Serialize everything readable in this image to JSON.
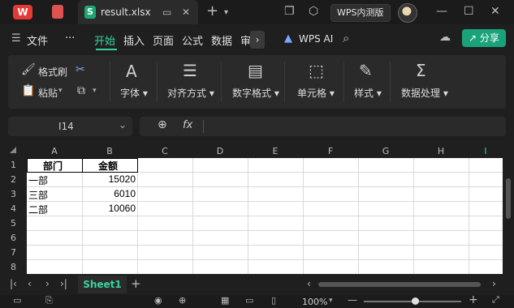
{
  "titlebar": {
    "app_logo": "W",
    "file_tab": "result.xlsx",
    "new_tab": "+",
    "badge": "WPS内测版"
  },
  "menubar": {
    "file": "文件",
    "more": "···",
    "items": [
      "开始",
      "插入",
      "页面",
      "公式",
      "数据",
      "审"
    ],
    "wps_ai": "WPS AI",
    "share": "分享"
  },
  "ribbon": {
    "format_painter": "格式刷",
    "paste": "粘贴",
    "font": "字体",
    "align": "对齐方式",
    "number_format": "数字格式",
    "cell": "单元格",
    "style": "样式",
    "data_process": "数据处理"
  },
  "formula_bar": {
    "name_box": "I14",
    "fx": "fx"
  },
  "grid": {
    "columns": [
      "A",
      "B",
      "C",
      "D",
      "E",
      "F",
      "G",
      "H",
      "I"
    ],
    "rows": [
      "1",
      "2",
      "3",
      "4",
      "5",
      "6",
      "7",
      "8"
    ],
    "header": [
      "部门",
      "金额"
    ],
    "data": [
      [
        "一部",
        "15020"
      ],
      [
        "三部",
        "6010"
      ],
      [
        "二部",
        "10060"
      ]
    ]
  },
  "sheets": {
    "active": "Sheet1",
    "add": "+"
  },
  "status": {
    "zoom": "100%"
  },
  "colors": {
    "accent": "#38d39f",
    "share_bg": "#1aa37a",
    "background": "#1f1f1f"
  }
}
